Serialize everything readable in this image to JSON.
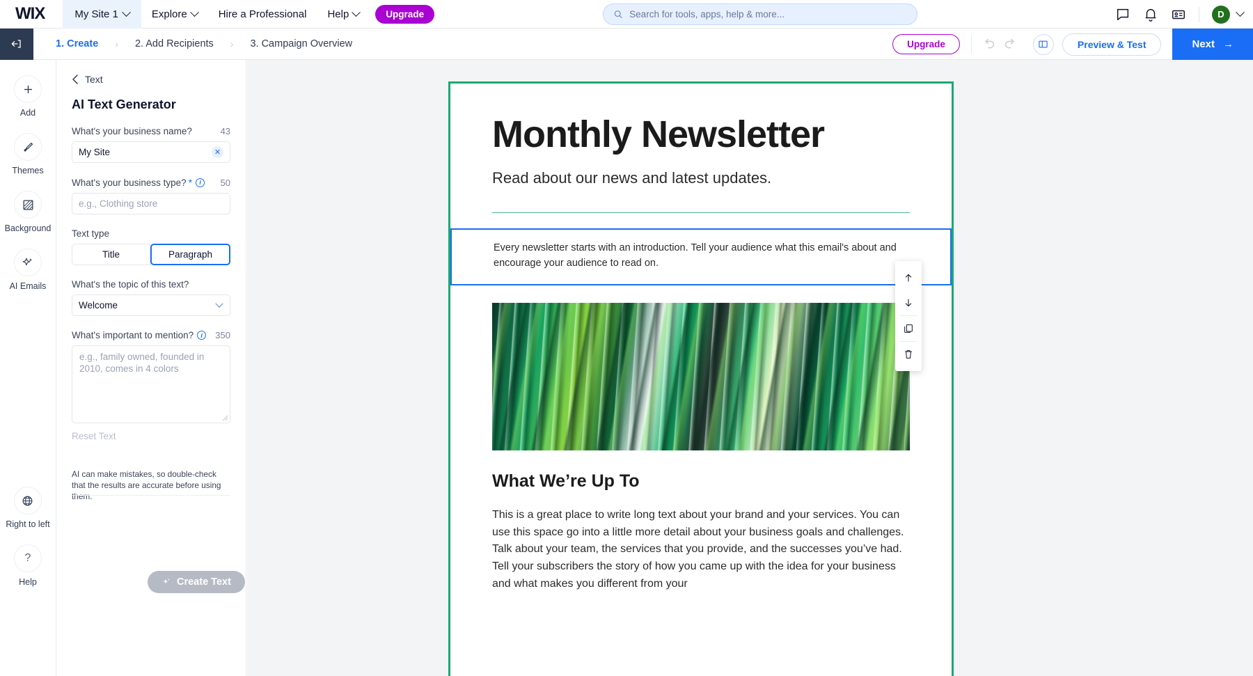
{
  "topbar": {
    "logo": "WIX",
    "site_name": "My Site 1",
    "menus": [
      "Explore",
      "Hire a Professional",
      "Help"
    ],
    "upgrade_label": "Upgrade",
    "search_placeholder": "Search for tools, apps, help & more...",
    "avatar_initial": "D",
    "icons": [
      "chat-icon",
      "bell-icon",
      "contact-card-icon"
    ]
  },
  "subbar": {
    "steps": [
      {
        "label": "1. Create",
        "active": true
      },
      {
        "label": "2. Add Recipients",
        "active": false
      },
      {
        "label": "3. Campaign Overview",
        "active": false
      }
    ],
    "upgrade_label": "Upgrade",
    "preview_label": "Preview & Test",
    "next_label": "Next",
    "next_arrow": "→"
  },
  "rail": {
    "items": [
      {
        "icon": "plus-icon",
        "label": "Add"
      },
      {
        "icon": "paintbrush-icon",
        "label": "Themes"
      },
      {
        "icon": "hatched-square-icon",
        "label": "Background"
      },
      {
        "icon": "sparkle-icon",
        "label": "AI Emails"
      }
    ],
    "bottom_items": [
      {
        "icon": "globe-icon",
        "label": "Right to left"
      },
      {
        "icon": "question-mark-icon",
        "label": "Help"
      }
    ]
  },
  "panel": {
    "back_label": "Text",
    "title": "AI Text Generator",
    "business_name": {
      "label": "What's your business name?",
      "counter": "43",
      "value": "My Site"
    },
    "business_type": {
      "label": "What's your business type?",
      "required_mark": "*",
      "counter": "50",
      "placeholder": "e.g., Clothing store",
      "value": ""
    },
    "text_type": {
      "label": "Text type",
      "options": [
        "Title",
        "Paragraph"
      ],
      "selected": "Paragraph"
    },
    "topic": {
      "label": "What's the topic of this text?",
      "value": "Welcome"
    },
    "important": {
      "label": "What's important to mention?",
      "counter": "350",
      "placeholder": "e.g., family owned, founded in 2010, comes in 4 colors",
      "value": ""
    },
    "reset_label": "Reset Text",
    "disclaimer": "AI can make mistakes, so double-check that the results are accurate before using them.",
    "create_label": "Create Text"
  },
  "email": {
    "title": "Monthly Newsletter",
    "subtitle": "Read about our news and latest updates.",
    "intro": "Every newsletter starts with an introduction. Tell your audience what this email's about and encourage your audience to read on.",
    "image_alt": "green-marbled-abstract-image",
    "section_title": "What We’re Up To",
    "section_body": "This is a great place to write long text about your brand and your services. You can use this space go into a little more detail about your business goals and challenges. Talk about your team, the services that you provide, and the successes you’ve had. Tell your subscribers the story of how you came up with the idea for your business and what makes you different from your"
  },
  "float_tools": {
    "items": [
      "move-up-icon",
      "move-down-icon",
      "duplicate-icon",
      "delete-icon"
    ]
  },
  "colors": {
    "accent_blue": "#1a6ef5",
    "brand_purple": "#aa00d4",
    "email_border_green": "#1aa971",
    "selection_blue": "#1a6ef5"
  }
}
